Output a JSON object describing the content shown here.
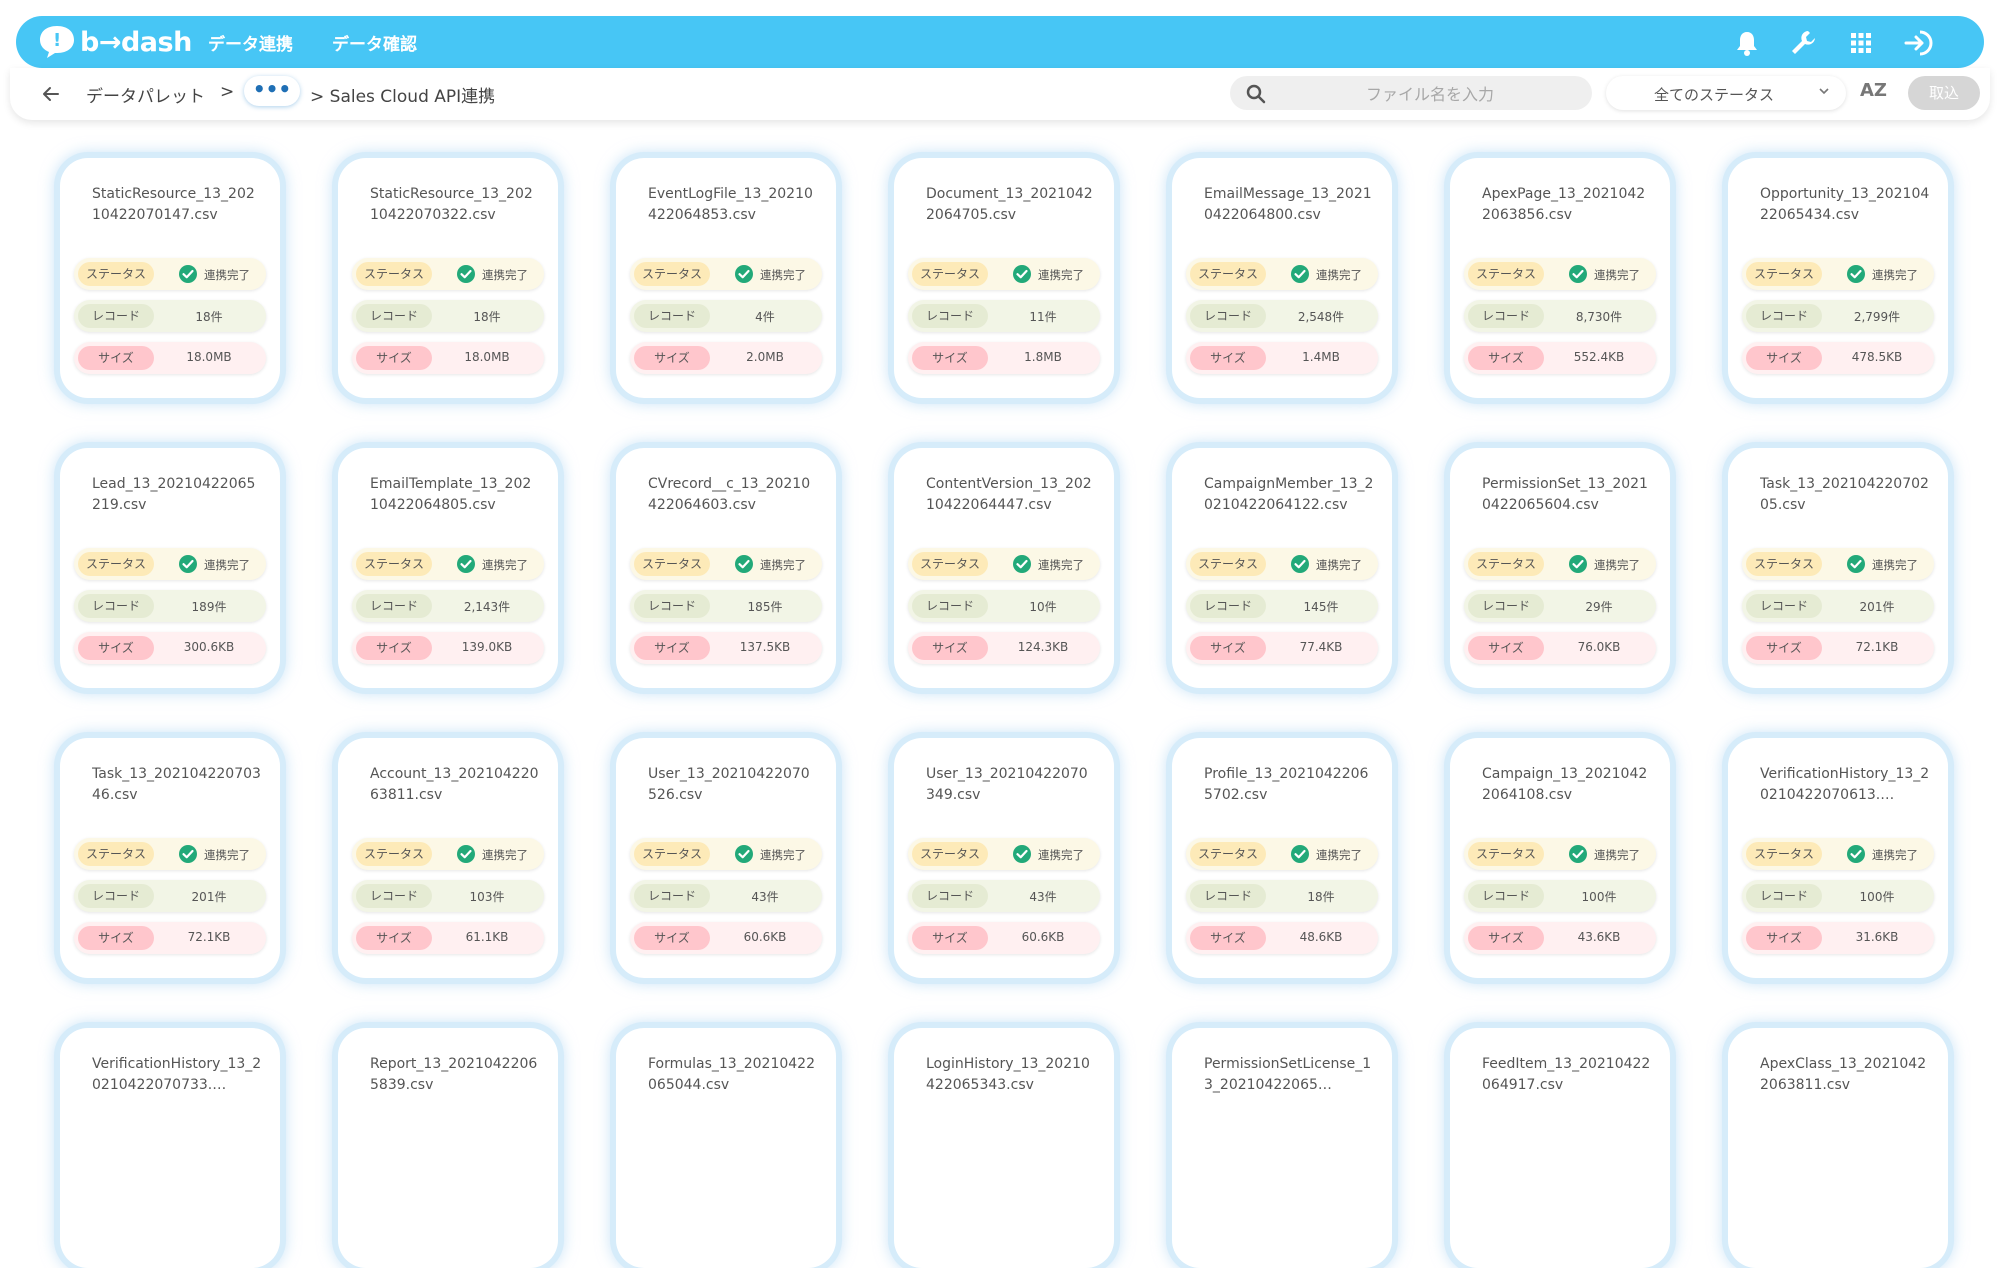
{
  "app": {
    "logo_text": "b→dash",
    "nav": [
      "データ連携",
      "データ確認"
    ]
  },
  "toolbar": {
    "breadcrumb_root": "データパレット",
    "breadcrumb_sep1": ">",
    "breadcrumb_dots": "•••",
    "breadcrumb_current": "> Sales Cloud API連携",
    "search_placeholder": "ファイル名を入力",
    "status_filter": "全てのステータス",
    "sort_label": "AZ",
    "import_label": "取込"
  },
  "labels": {
    "status": "ステータス",
    "record": "レコード",
    "size": "サイズ"
  },
  "colors": {
    "brand": "#47c6f5",
    "check": "#22a979"
  },
  "files": [
    {
      "name": "StaticResource_13_20210422070147.csv",
      "status": "連携完了",
      "records": "18件",
      "size": "18.0MB"
    },
    {
      "name": "StaticResource_13_20210422070322.csv",
      "status": "連携完了",
      "records": "18件",
      "size": "18.0MB"
    },
    {
      "name": "EventLogFile_13_20210422064853.csv",
      "status": "連携完了",
      "records": "4件",
      "size": "2.0MB"
    },
    {
      "name": "Document_13_20210422064705.csv",
      "status": "連携完了",
      "records": "11件",
      "size": "1.8MB"
    },
    {
      "name": "EmailMessage_13_20210422064800.csv",
      "status": "連携完了",
      "records": "2,548件",
      "size": "1.4MB"
    },
    {
      "name": "ApexPage_13_2021042206385​6.csv",
      "status": "連携完了",
      "records": "8,730件",
      "size": "552.4KB"
    },
    {
      "name": "Opportunity_13_20210422065434.csv",
      "status": "連携完了",
      "records": "2,799件",
      "size": "478.5KB"
    },
    {
      "name": "Lead_13_20210422065219.csv",
      "status": "連携完了",
      "records": "189件",
      "size": "300.6KB"
    },
    {
      "name": "EmailTemplate_13_20210422064805.csv",
      "status": "連携完了",
      "records": "2,143件",
      "size": "139.0KB"
    },
    {
      "name": "CVrecord__c_13_20210422064603.csv",
      "status": "連携完了",
      "records": "185件",
      "size": "137.5KB"
    },
    {
      "name": "ContentVersion_13_20210422064447.csv",
      "status": "連携完了",
      "records": "10件",
      "size": "124.3KB"
    },
    {
      "name": "CampaignMember_13_20210422064122.csv",
      "status": "連携完了",
      "records": "145件",
      "size": "77.4KB"
    },
    {
      "name": "PermissionSet_13_20210422065604.csv",
      "status": "連携完了",
      "records": "29件",
      "size": "76.0KB"
    },
    {
      "name": "Task_13_20210422070205.csv",
      "status": "連携完了",
      "records": "201件",
      "size": "72.1KB"
    },
    {
      "name": "Task_13_20210422070346.csv",
      "status": "連携完了",
      "records": "201件",
      "size": "72.1KB"
    },
    {
      "name": "Account_13_20210422063811.csv",
      "status": "連携完了",
      "records": "103件",
      "size": "61.1KB"
    },
    {
      "name": "User_13_20210422070526.csv",
      "status": "連携完了",
      "records": "43件",
      "size": "60.6KB"
    },
    {
      "name": "User_13_20210422070349.csv",
      "status": "連携完了",
      "records": "43件",
      "size": "60.6KB"
    },
    {
      "name": "Profile_13_20210422065702.csv",
      "status": "連携完了",
      "records": "18件",
      "size": "48.6KB"
    },
    {
      "name": "Campaign_13_20210422064108.csv",
      "status": "連携完了",
      "records": "100件",
      "size": "43.6KB"
    },
    {
      "name": "VerificationHistory_13_20210422070613.…",
      "status": "連携完了",
      "records": "100件",
      "size": "31.6KB"
    },
    {
      "name": "VerificationHistory_13_20210422070733.…",
      "status": "",
      "records": "",
      "size": ""
    },
    {
      "name": "Report_13_20210422065839.csv",
      "status": "",
      "records": "",
      "size": ""
    },
    {
      "name": "Formulas_13_20210422065044.csv",
      "status": "",
      "records": "",
      "size": ""
    },
    {
      "name": "LoginHistory_13_20210422065343.csv",
      "status": "",
      "records": "",
      "size": ""
    },
    {
      "name": "PermissionSetLicense_13_20210422065…",
      "status": "",
      "records": "",
      "size": ""
    },
    {
      "name": "FeedItem_13_20210422064917.csv",
      "status": "",
      "records": "",
      "size": ""
    },
    {
      "name": "ApexClass_13_20210422063811.csv",
      "status": "",
      "records": "",
      "size": ""
    }
  ]
}
